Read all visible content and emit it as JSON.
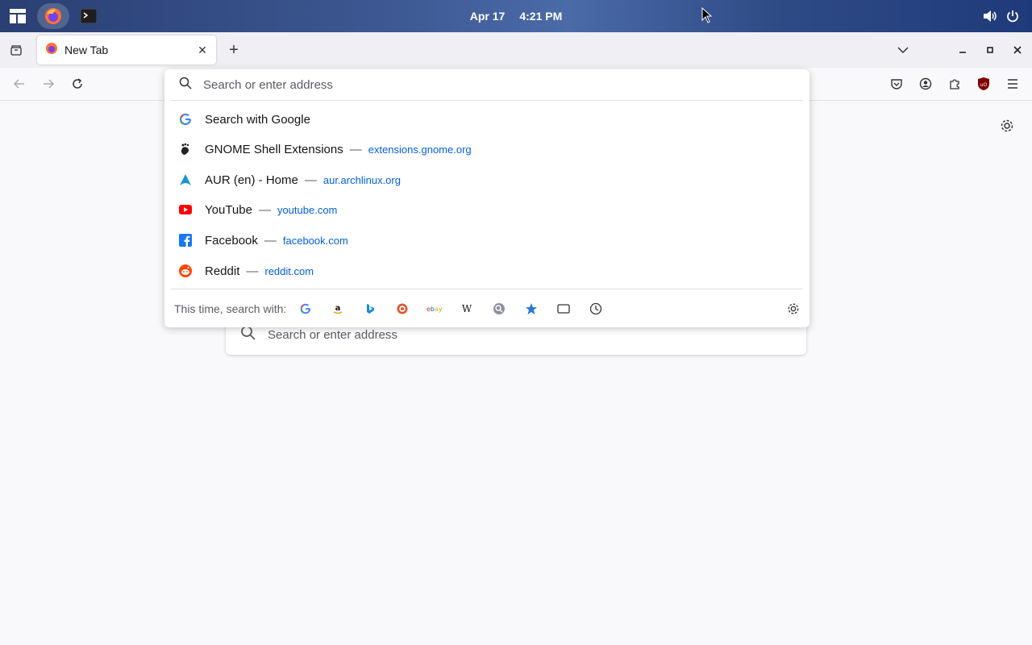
{
  "topbar": {
    "date": "Apr 17",
    "time": "4:21 PM"
  },
  "tabs": [
    {
      "title": "New Tab"
    }
  ],
  "new_tab_label": "+",
  "close_tab_label": "✕",
  "urlbar": {
    "placeholder": "Search or enter address"
  },
  "results": [
    {
      "title": "Search with Google",
      "url": "",
      "icon": "google-icon"
    },
    {
      "title": "GNOME Shell Extensions",
      "url": "extensions.gnome.org",
      "icon": "gnome-icon"
    },
    {
      "title": "AUR (en) - Home",
      "url": "aur.archlinux.org",
      "icon": "arch-icon"
    },
    {
      "title": "YouTube",
      "url": "youtube.com",
      "icon": "youtube-icon"
    },
    {
      "title": "Facebook",
      "url": "facebook.com",
      "icon": "facebook-icon"
    },
    {
      "title": "Reddit",
      "url": "reddit.com",
      "icon": "reddit-icon"
    }
  ],
  "separator": "—",
  "oneoff": {
    "label": "This time, search with:",
    "engines": [
      "google-icon",
      "amazon-icon",
      "bing-icon",
      "duckduckgo-icon",
      "ebay-icon",
      "wikipedia-icon",
      "search-icon",
      "bookmarks-icon",
      "tabs-icon",
      "history-icon"
    ]
  },
  "ntp": {
    "search_placeholder": "Search or enter address"
  },
  "colors": {
    "accent": "#0060df",
    "ublock": "#800000",
    "youtube": "#ff0000",
    "facebook": "#1877f2",
    "reddit": "#ff4500",
    "arch": "#1793d1"
  }
}
